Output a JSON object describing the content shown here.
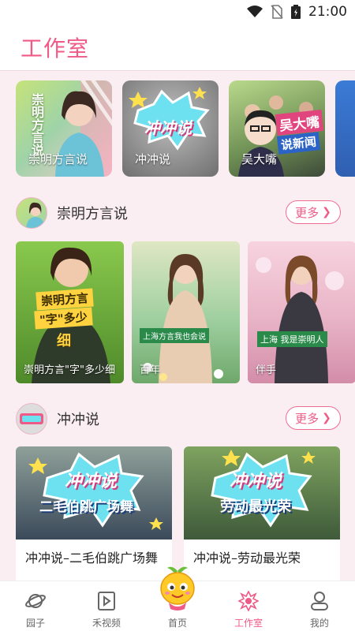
{
  "status": {
    "time": "21:00"
  },
  "header": {
    "title": "工作室"
  },
  "channels": [
    {
      "label": "崇明方言说",
      "cover_text": "崇明方言说"
    },
    {
      "label": "冲冲说",
      "cover_text": "冲冲说"
    },
    {
      "label": "吴大嘴",
      "cover_text": "吴大嘴",
      "cover_sub": "说新闻"
    },
    {
      "label": "",
      "cover_text": ""
    }
  ],
  "section1": {
    "title": "崇明方言说",
    "more": "更多",
    "videos": [
      {
        "label": "崇明方言\"字\"多少细",
        "cover_text": "崇明方言",
        "cover_sub": "\"字\"多少",
        "cover_sub2": "细"
      },
      {
        "label": "百年",
        "caption": "上海方言我也会说"
      },
      {
        "label": "伴手",
        "caption": "上海 我是崇明人"
      }
    ]
  },
  "section2": {
    "title": "冲冲说",
    "more": "更多",
    "videos": [
      {
        "label": "冲冲说–二毛伯跳广场舞",
        "cover_text": "冲冲说",
        "cover_sub": "二毛伯跳广场舞"
      },
      {
        "label": "冲冲说–劳动最光荣",
        "cover_text": "冲冲说",
        "cover_sub": "劳动最光荣"
      }
    ]
  },
  "tabs": [
    {
      "label": "园子",
      "icon": "planet-icon"
    },
    {
      "label": "禾视频",
      "icon": "play-icon"
    },
    {
      "label": "首页",
      "icon": "home-mascot-icon"
    },
    {
      "label": "工作室",
      "icon": "studio-icon",
      "active": true
    },
    {
      "label": "我的",
      "icon": "user-icon"
    }
  ],
  "colors": {
    "accent": "#ef5b86",
    "background": "#fbeef2"
  }
}
